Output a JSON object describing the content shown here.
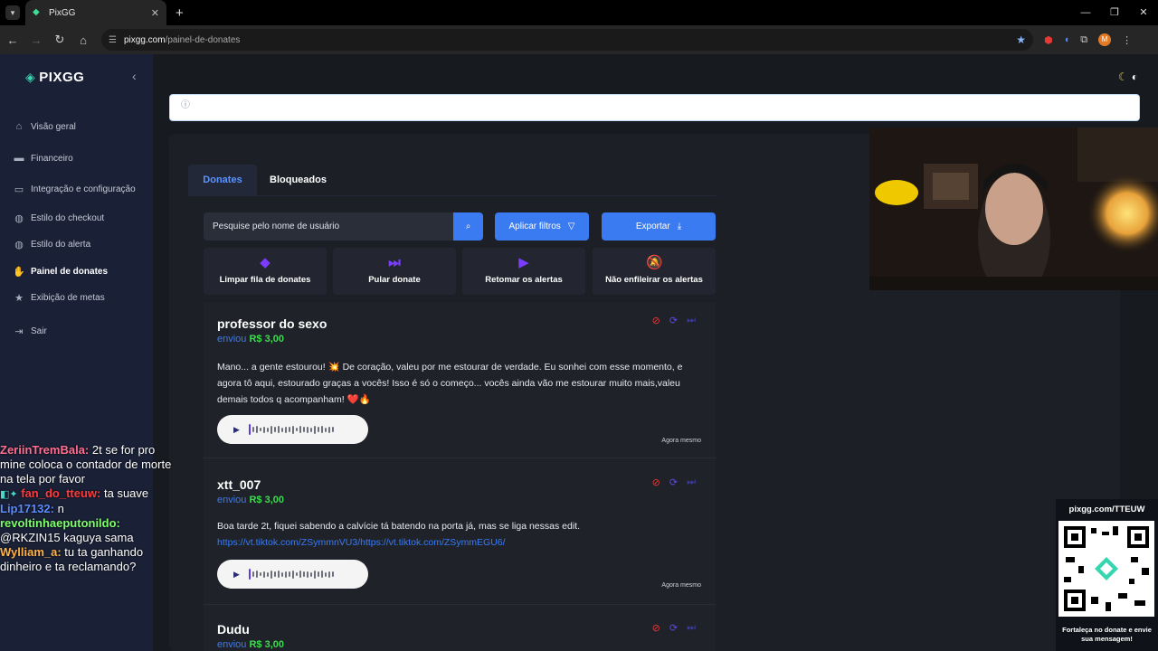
{
  "browser": {
    "tab_title": "PixGG",
    "url_host": "pixgg.com",
    "url_path": "/painel-de-donates"
  },
  "sidebar": {
    "logo": "PIXGG",
    "items": [
      {
        "label": "Visão geral",
        "icon": "home-icon"
      },
      {
        "label": "Financeiro",
        "icon": "wallet-icon"
      },
      {
        "label": "Integração e configuração",
        "icon": "plug-icon"
      },
      {
        "label": "Estilo do checkout",
        "icon": "palette-icon"
      },
      {
        "label": "Estilo do alerta",
        "icon": "palette-icon"
      },
      {
        "label": "Painel de donates",
        "icon": "donate-icon"
      },
      {
        "label": "Exibição de metas",
        "icon": "star-icon"
      },
      {
        "label": "Sair",
        "icon": "logout-icon"
      }
    ],
    "active": "Painel de donates"
  },
  "tabs": [
    {
      "label": "Donates",
      "active": true
    },
    {
      "label": "Bloqueados",
      "active": false
    }
  ],
  "search": {
    "placeholder": "Pesquise pelo nome de usuário"
  },
  "buttons": {
    "filters": "Aplicar filtros",
    "export": "Exportar"
  },
  "actions": [
    {
      "label": "Limpar fila de donates",
      "icon": "eraser-icon"
    },
    {
      "label": "Pular donate",
      "icon": "skip-icon"
    },
    {
      "label": "Retomar os alertas",
      "icon": "play-circle-icon"
    },
    {
      "label": "Não enfileirar os alertas",
      "icon": "bell-off-icon"
    }
  ],
  "donates": [
    {
      "name": "professor do sexo",
      "verb": "enviou",
      "amount": "R$ 3,00",
      "message": "Mano... a gente estourou! 💥 De coração, valeu por me estourar de verdade. Eu sonhei com esse momento, e agora tô aqui, estourado graças a vocês! Isso é só o começo... vocês ainda vão me estourar muito mais,valeu demais todos q acompanham! ❤️🔥",
      "link": "",
      "time": "Agora mesmo"
    },
    {
      "name": "xtt_007",
      "verb": "enviou",
      "amount": "R$ 3,00",
      "message": "Boa tarde 2t, fiquei sabendo a calvície tá batendo na porta já, mas se liga nessas edit.",
      "link": "https://vt.tiktok.com/ZSymmnVU3/https://vt.tiktok.com/ZSymmEGU6/",
      "time": "Agora mesmo"
    },
    {
      "name": "Dudu",
      "verb": "enviou",
      "amount": "R$ 3,00",
      "message": "",
      "link": "",
      "time": ""
    }
  ],
  "chat": [
    {
      "user": "ZeriinTremBala:",
      "text": " 2t se for pro mine coloca o contador de morte na tela por favor"
    },
    {
      "user": "fan_do_tteuw:",
      "text": " ta suave"
    },
    {
      "user": "Lip17132:",
      "text": " n"
    },
    {
      "user": "revoltinhaeputonildo:",
      "text": " @RKZIN15 kaguya sama"
    },
    {
      "user": "Wylliam_a:",
      "text": " tu ta ganhando dinheiro e ta reclamando?"
    }
  ],
  "qr": {
    "url": "pixgg.com/TTEUW",
    "caption": "Fortaleça no donate e envie sua mensagem!"
  },
  "colors": {
    "accent": "#3a7bf2",
    "amount": "#3ddc50",
    "sidebar": "#1a2036"
  }
}
